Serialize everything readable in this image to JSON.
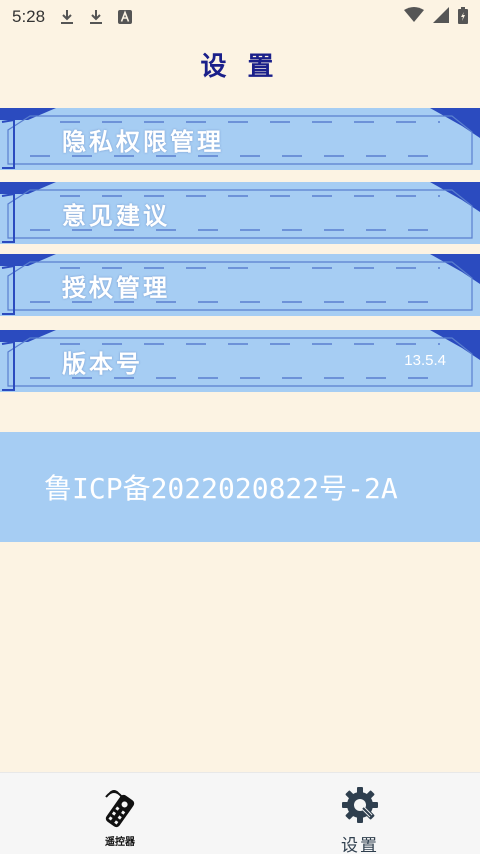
{
  "status_bar": {
    "time": "5:28",
    "left_icons": [
      "download-icon",
      "download-icon",
      "font-icon"
    ],
    "right_icons": [
      "wifi-icon",
      "signal-icon",
      "battery-icon"
    ]
  },
  "header": {
    "title": "设 置"
  },
  "menu": {
    "items": [
      {
        "label": "隐私权限管理",
        "value": ""
      },
      {
        "label": "意见建议",
        "value": ""
      },
      {
        "label": "授权管理",
        "value": ""
      },
      {
        "label": "版本号",
        "value": "13.5.4"
      }
    ]
  },
  "footer_banner": {
    "icp": "鲁ICP备2022020822号-2A"
  },
  "bottom_nav": {
    "remote_label": "遥控器",
    "settings_label": "设置"
  },
  "colors": {
    "background": "#fcf3e3",
    "panel": "#a6cdf3",
    "panel_accent": "#2b4bbf",
    "title": "#1a1f8a"
  }
}
